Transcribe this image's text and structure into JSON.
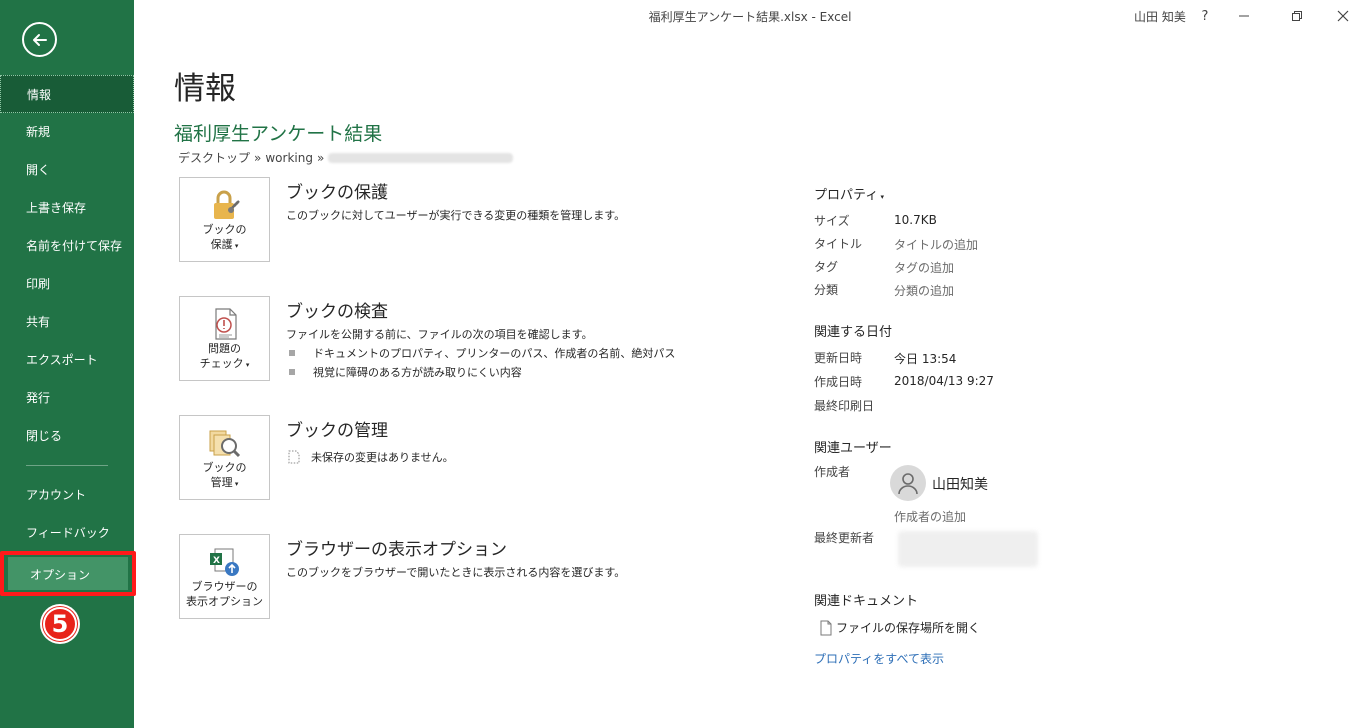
{
  "window": {
    "title": "福利厚生アンケート結果.xlsx  -  Excel",
    "user": "山田 知美",
    "help_label": "?",
    "minimize_label": "—",
    "restore_label": "❐",
    "close_label": "✕"
  },
  "sidebar": {
    "items": [
      {
        "label": "情報"
      },
      {
        "label": "新規"
      },
      {
        "label": "開く"
      },
      {
        "label": "上書き保存"
      },
      {
        "label": "名前を付けて保存"
      },
      {
        "label": "印刷"
      },
      {
        "label": "共有"
      },
      {
        "label": "エクスポート"
      },
      {
        "label": "発行"
      },
      {
        "label": "閉じる"
      }
    ],
    "bottom_items": [
      {
        "label": "アカウント"
      },
      {
        "label": "フィードバック"
      },
      {
        "label": "オプション"
      }
    ],
    "step_badge": "5",
    "highlight_color": "#ff1a1a",
    "brand_color": "#217346"
  },
  "main": {
    "page_title": "情報",
    "file_title": "福利厚生アンケート結果",
    "breadcrumb": [
      "デスクトップ",
      "working"
    ],
    "breadcrumb_sep": "»",
    "sections": [
      {
        "button_label_1": "ブックの",
        "button_label_2": "保護",
        "title": "ブックの保護",
        "desc": "このブックに対してユーザーが実行できる変更の種類を管理します。",
        "icon": "lock-icon"
      },
      {
        "button_label_1": "問題の",
        "button_label_2": "チェック",
        "title": "ブックの検査",
        "desc": "ファイルを公開する前に、ファイルの次の項目を確認します。",
        "bullets": [
          "ドキュメントのプロパティ、プリンターのパス、作成者の名前、絶対パス",
          "視覚に障碍のある方が読み取りにくい内容"
        ],
        "icon": "inspect-document-icon"
      },
      {
        "button_label_1": "ブックの",
        "button_label_2": "管理",
        "title": "ブックの管理",
        "desc": "未保存の変更はありません。",
        "icon": "manage-workbook-icon"
      },
      {
        "button_label_1": "ブラウザーの",
        "button_label_2": "表示オプション",
        "title": "ブラウザーの表示オプション",
        "desc": "このブックをブラウザーで開いたときに表示される内容を選びます。",
        "icon": "browser-view-icon"
      }
    ]
  },
  "properties": {
    "header": "プロパティ",
    "rows": [
      {
        "key": "サイズ",
        "value": "10.7KB"
      },
      {
        "key": "タイトル",
        "value": "タイトルの追加"
      },
      {
        "key": "タグ",
        "value": "タグの追加"
      },
      {
        "key": "分類",
        "value": "分類の追加"
      }
    ],
    "dates_header": "関連する日付",
    "dates": [
      {
        "key": "更新日時",
        "value": "今日 13:54"
      },
      {
        "key": "作成日時",
        "value": "2018/04/13 9:27"
      },
      {
        "key": "最終印刷日",
        "value": ""
      }
    ],
    "users_header": "関連ユーザー",
    "author_label": "作成者",
    "author_name": "山田知美",
    "add_author": "作成者の追加",
    "last_modified_label": "最終更新者",
    "docs_header": "関連ドキュメント",
    "open_location": "ファイルの保存場所を開く",
    "show_all": "プロパティをすべて表示"
  }
}
